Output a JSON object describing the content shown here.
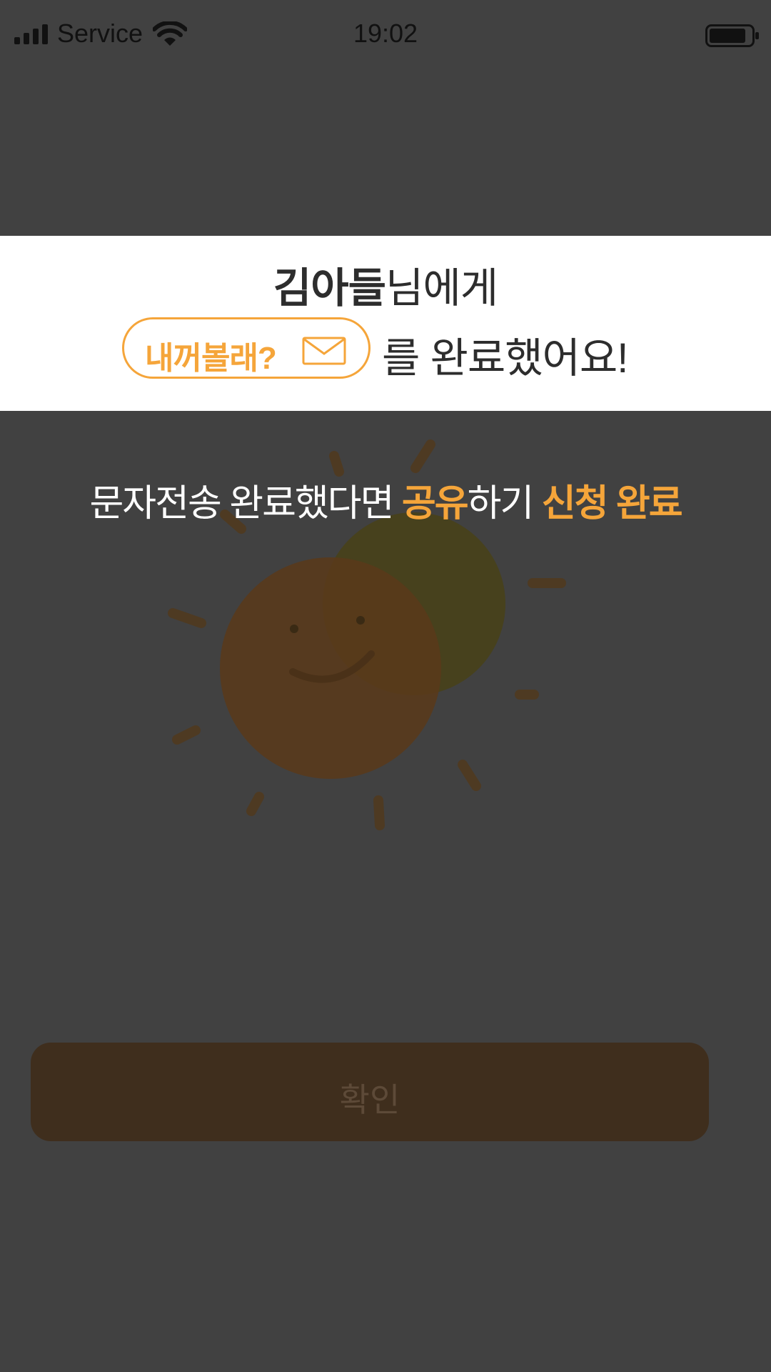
{
  "status_bar": {
    "carrier": "Service",
    "time": "19:02",
    "icons": [
      "signal-icon",
      "wifi-icon",
      "battery-icon"
    ]
  },
  "banner": {
    "recipient_name": "김아들",
    "recipient_suffix": "님에게",
    "pill_label": "내꺼볼래?",
    "pill_icon": "envelope-icon",
    "completion_text": "를 완료했어요!"
  },
  "headline": {
    "part1": "문자전송 완료했다면 ",
    "highlight1": "공유",
    "part2": "하기 ",
    "highlight2": "신청 완료"
  },
  "illustration": {
    "icon": "smiling-sun-illustration"
  },
  "confirm_button": {
    "label": "확인"
  },
  "colors": {
    "accent": "#f5a53a",
    "overlay": "#414141",
    "banner_bg": "#ffffff",
    "text_dark": "#2d2d2d",
    "button_bg": "#3f2e1d"
  }
}
